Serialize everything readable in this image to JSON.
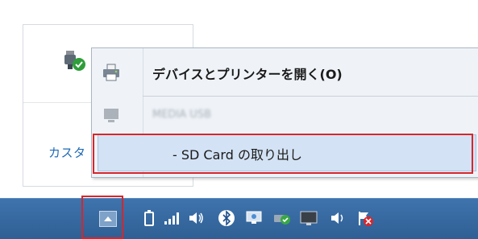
{
  "tray_panel": {
    "usb_icon": "usb-device-checkmark-icon",
    "customize_link": "カスタ"
  },
  "context_menu": {
    "items": [
      {
        "label": "デバイスとプリンターを開く(O)",
        "icon": "printer-icon",
        "bold": true
      },
      {
        "label": "MEDIA USB",
        "icon": "drive-icon",
        "disabled": true
      },
      {
        "label": "-   SD Card の取り出し",
        "icon": "",
        "highlighted": true
      }
    ]
  },
  "taskbar": {
    "show_hidden_icon": "chevron-up-icon",
    "tray_icons": [
      "battery-icon",
      "signal-icon",
      "volume-icon",
      "bluetooth-icon",
      "display-icon",
      "safely-remove-icon",
      "monitor-icon",
      "speaker-icon",
      "flag-error-icon"
    ]
  },
  "colors": {
    "taskbar": "#3a6ea5",
    "menu_bg": "#eff3f8",
    "highlight": "#d3e2f4",
    "annotation_red": "#d6262c",
    "link": "#1e6ab6"
  }
}
